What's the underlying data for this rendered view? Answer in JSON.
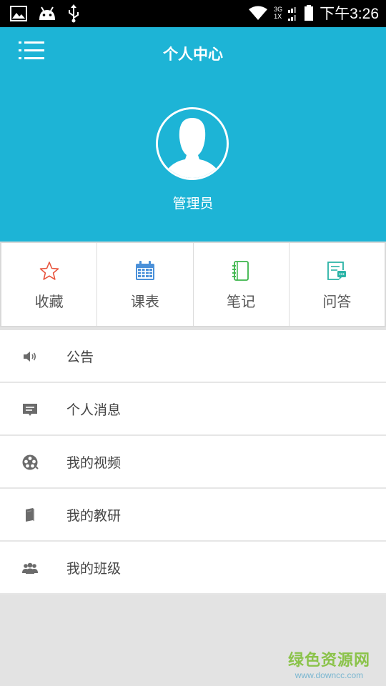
{
  "status_bar": {
    "network_top": "3G",
    "network_bottom": "1X",
    "time": "下午3:26"
  },
  "header": {
    "title": "个人中心",
    "user_name": "管理员"
  },
  "quick_actions": [
    {
      "label": "收藏",
      "icon": "star-icon",
      "color": "#e8553e"
    },
    {
      "label": "课表",
      "icon": "calendar-icon",
      "color": "#4a90d9"
    },
    {
      "label": "笔记",
      "icon": "notebook-icon",
      "color": "#3bb54a"
    },
    {
      "label": "问答",
      "icon": "qa-icon",
      "color": "#2ab3a6"
    }
  ],
  "menu": [
    {
      "label": "公告",
      "icon": "speaker-icon"
    },
    {
      "label": "个人消息",
      "icon": "message-icon"
    },
    {
      "label": "我的视频",
      "icon": "film-reel-icon"
    },
    {
      "label": "我的教研",
      "icon": "book-icon"
    },
    {
      "label": "我的班级",
      "icon": "group-icon"
    }
  ],
  "watermark": {
    "name": "绿色资源网",
    "url": "www.downcc.com"
  },
  "colors": {
    "header_bg": "#1db4d6",
    "page_bg": "#e3e3e3"
  }
}
